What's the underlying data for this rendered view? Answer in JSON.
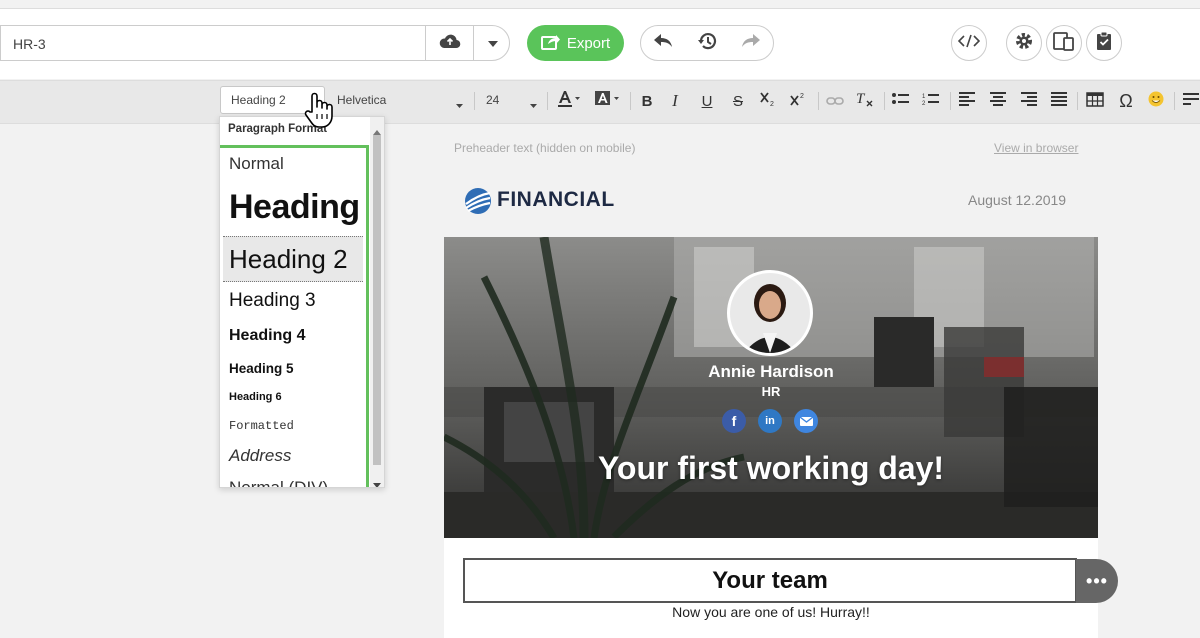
{
  "header": {
    "template_name": "HR-3",
    "export_label": "Export"
  },
  "toolbar": {
    "paragraph_format_value": "Heading 2",
    "font_family_value": "Helvetica",
    "font_size_value": "24",
    "bold_label": "B",
    "italic_label": "I",
    "underline_label": "U",
    "strike_label": "S",
    "omega_label": "Ω"
  },
  "paragraph_dropdown": {
    "title": "Paragraph Format",
    "items": [
      {
        "label": "Normal"
      },
      {
        "label": "Heading"
      },
      {
        "label": "Heading 2"
      },
      {
        "label": "Heading 3"
      },
      {
        "label": "Heading 4"
      },
      {
        "label": "Heading 5"
      },
      {
        "label": "Heading 6"
      },
      {
        "label": "Formatted"
      },
      {
        "label": "Address"
      },
      {
        "label": "Normal (DIV)"
      }
    ],
    "selected_index": 2
  },
  "email": {
    "preheader": "Preheader text (hidden on mobile)",
    "view_in_browser": "View in browser",
    "logo_text": "FINANCIAL",
    "date": "August 12.2019",
    "person_name": "Annie Hardison",
    "person_role": "HR",
    "hero_title": "Your first working day!",
    "team_heading": "Your team",
    "team_text": "Now you are one of us! Hurray!!",
    "more_label": "•••"
  },
  "colors": {
    "accent_green": "#5ac45a",
    "dropdown_highlight": "#63c05c",
    "logo_blue": "#2f6db5"
  }
}
